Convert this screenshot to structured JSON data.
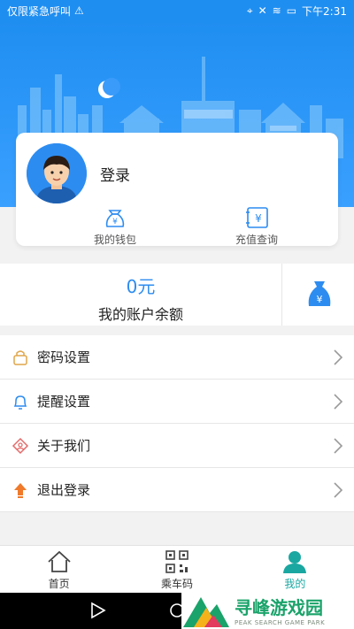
{
  "status_bar": {
    "left_text": "仅限紧急呼叫",
    "time": "下午2:31"
  },
  "profile": {
    "login_label": "登录",
    "wallet_label": "我的钱包",
    "recharge_label": "充值查询"
  },
  "balance": {
    "amount": "0元",
    "label": "我的账户余额"
  },
  "menu": {
    "items": [
      {
        "label": "密码设置",
        "icon": "lock-icon"
      },
      {
        "label": "提醒设置",
        "icon": "bell-icon"
      },
      {
        "label": "关于我们",
        "icon": "info-icon"
      },
      {
        "label": "退出登录",
        "icon": "logout-icon"
      }
    ]
  },
  "tabs": {
    "home": "首页",
    "ride_code": "乘车码",
    "mine": "我的"
  },
  "watermark": {
    "title": "寻峰游戏园",
    "subtitle": "PEAK SEARCH GAME PARK"
  },
  "colors": {
    "primary": "#1f8ef1",
    "accent": "#2d8cf0",
    "tab_active": "#1aa7a1"
  }
}
